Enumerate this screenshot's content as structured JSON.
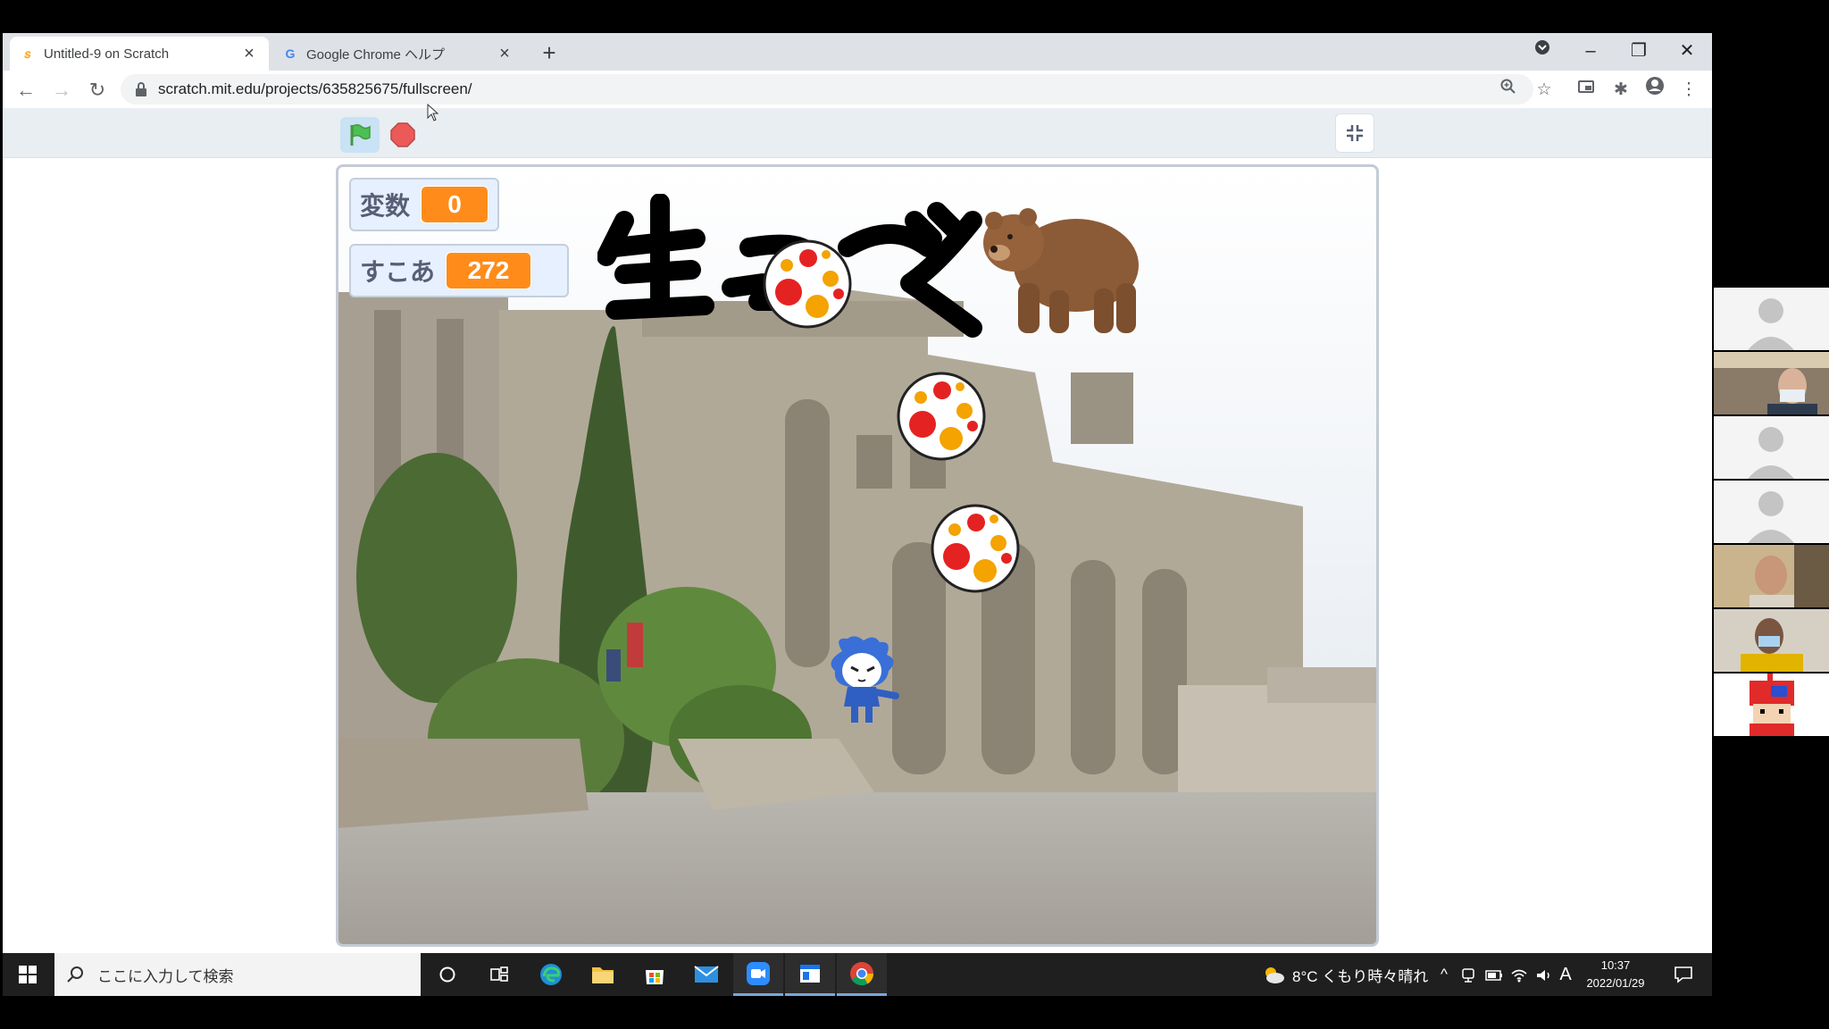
{
  "browser": {
    "tabs": [
      {
        "title": "Untitled-9 on Scratch",
        "favicon": "scratch-cat-icon",
        "active": true
      },
      {
        "title": "Google Chrome ヘルプ",
        "favicon": "google-g-icon",
        "active": false
      }
    ],
    "new_tab_label": "+",
    "url": "scratch.mit.edu/projects/635825675/fullscreen/"
  },
  "scratch": {
    "monitors": [
      {
        "label": "変数",
        "value": "0"
      },
      {
        "label": "すこあ",
        "value": "272"
      }
    ],
    "title_drawing_text": "生つづく"
  },
  "taskbar": {
    "search_placeholder": "ここに入力して検索",
    "weather": "8°C くもり時々晴れ",
    "ime_indicator": "A",
    "time": "10:37",
    "date": "2022/01/29"
  },
  "colors": {
    "monitor_value": "#ff8c1a",
    "green_flag": "#4cbf56",
    "stop": "#ec5959",
    "taskbar": "#1f1f1f"
  }
}
